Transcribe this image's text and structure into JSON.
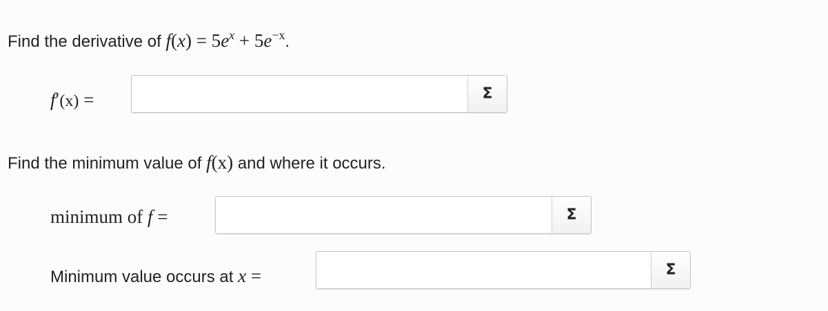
{
  "question1": {
    "prefix": "Find the derivative of ",
    "f": "f",
    "open": "(",
    "x": "x",
    "close": ")",
    "eq": " = 5",
    "e1": "e",
    "exp1": "x",
    "plus": " + 5",
    "e2": "e",
    "exp2": "−x",
    "period": "."
  },
  "derivative": {
    "f": "f",
    "prime": "′",
    "arg": "(x)",
    "eq": " =",
    "value": "",
    "sigma": "Σ"
  },
  "question2": {
    "prefix": "Find the minimum value of ",
    "f": "f",
    "arg": "(x)",
    "suffix": " and where it occurs."
  },
  "minimum": {
    "label_text": "minimum of ",
    "f": "f",
    "eq": " =",
    "value": "",
    "sigma": "Σ"
  },
  "location": {
    "label_text": "Minimum value occurs at ",
    "x": "x",
    "eq": " =",
    "value": "",
    "sigma": "Σ"
  }
}
